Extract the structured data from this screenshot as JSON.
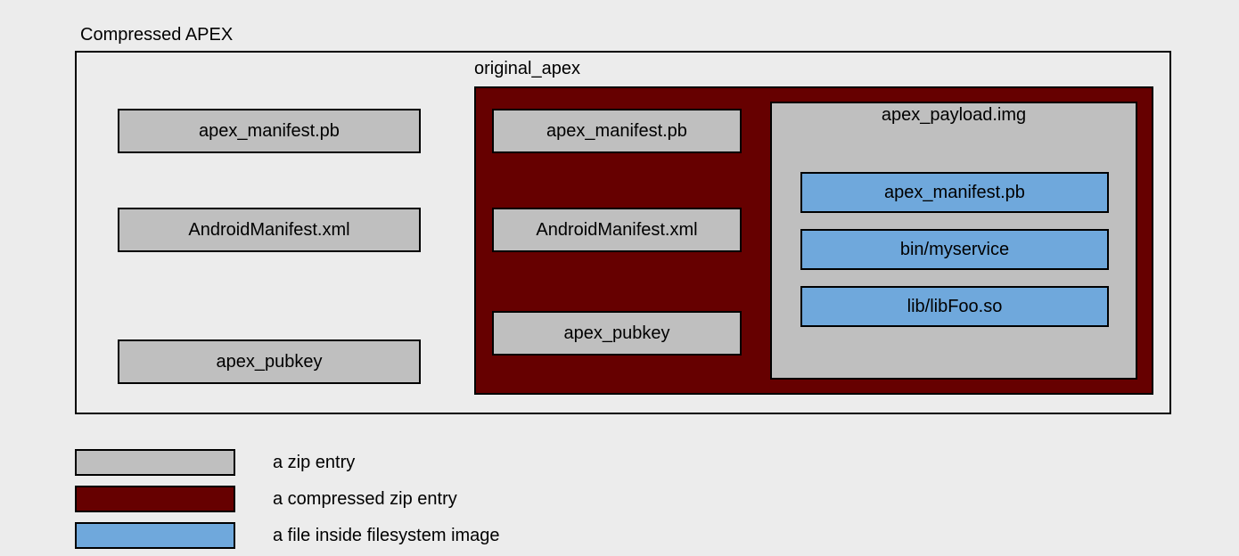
{
  "diagram": {
    "title": "Compressed APEX",
    "original_label": "original_apex",
    "left_entries": {
      "e1": "apex_manifest.pb",
      "e2": "AndroidManifest.xml",
      "e3": "apex_pubkey"
    },
    "compressed_entries": {
      "e1": "apex_manifest.pb",
      "e2": "AndroidManifest.xml",
      "e3": "apex_pubkey"
    },
    "payload": {
      "title": "apex_payload.img",
      "files": {
        "f1": "apex_manifest.pb",
        "f2": "bin/myservice",
        "f3": "lib/libFoo.so"
      }
    },
    "legend": {
      "zip": "a zip entry",
      "compressed": "a compressed zip entry",
      "file": "a file inside filesystem image"
    },
    "colors": {
      "zip_entry": "#bfbfbf",
      "compressed": "#660000",
      "file_entry": "#6fa8dc",
      "background": "#ececec"
    }
  }
}
